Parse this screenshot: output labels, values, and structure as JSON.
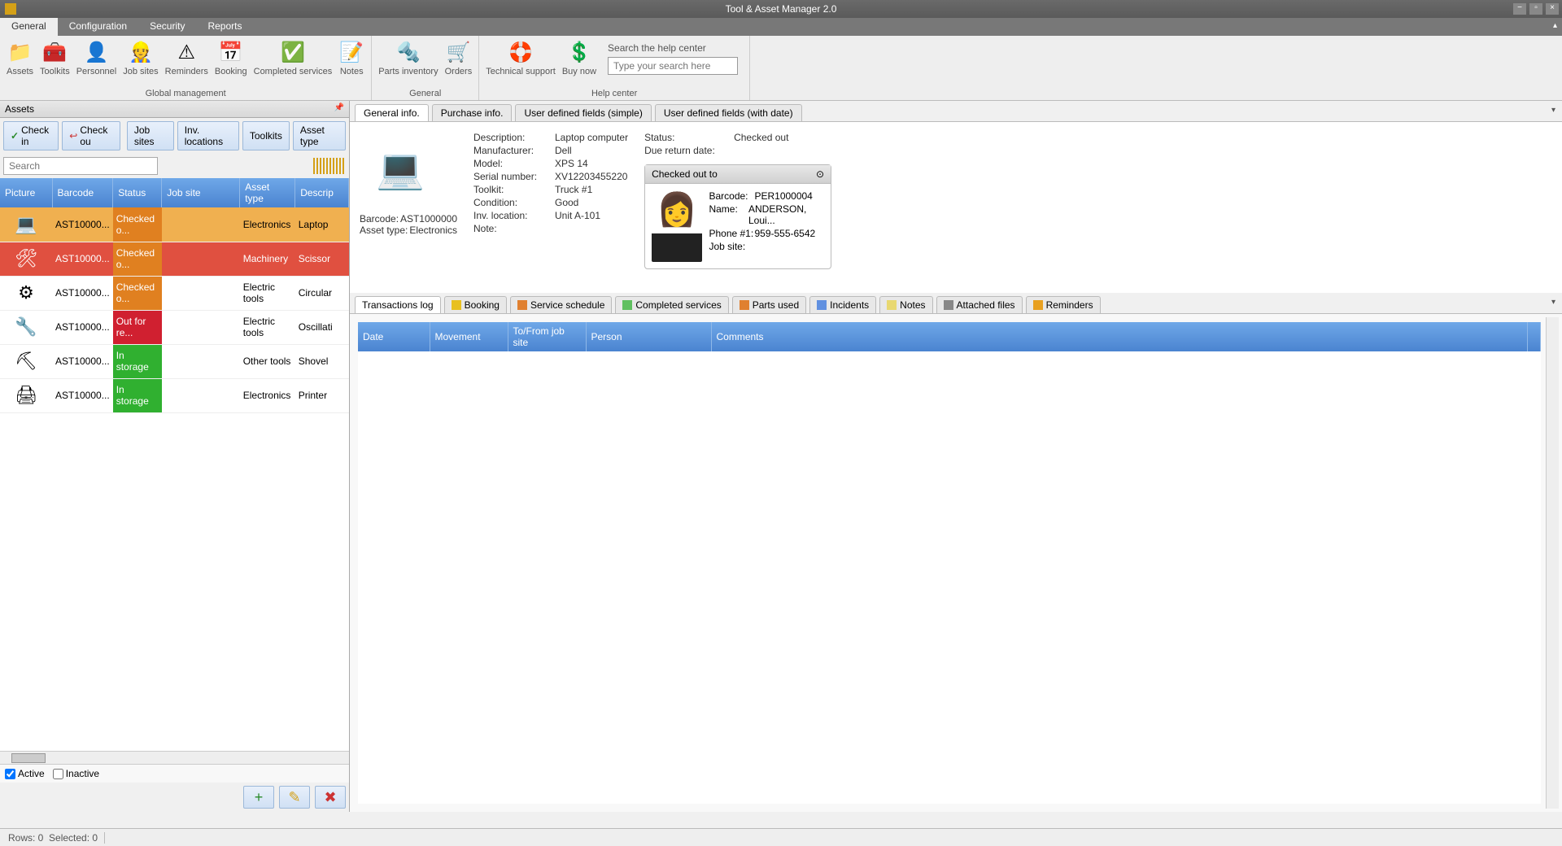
{
  "titlebar": {
    "title": "Tool & Asset Manager 2.0"
  },
  "tabs": {
    "general": "General",
    "config": "Configuration",
    "security": "Security",
    "reports": "Reports"
  },
  "ribbon": {
    "assets": "Assets",
    "toolkits": "Toolkits",
    "personnel": "Personnel",
    "jobsites": "Job sites",
    "reminders": "Reminders",
    "booking": "Booking",
    "completed": "Completed services",
    "notes": "Notes",
    "parts": "Parts inventory",
    "orders": "Orders",
    "support": "Technical support",
    "buy": "Buy now",
    "group1": "Global management",
    "group2": "General",
    "group3": "Help center",
    "searchLabel": "Search the help center",
    "searchPlaceholder": "Type your search here"
  },
  "leftPanel": {
    "title": "Assets",
    "checkin": "Check in",
    "checkout": "Check ou",
    "jobsites": "Job sites",
    "invloc": "Inv. locations",
    "toolkits": "Toolkits",
    "assettype": "Asset type",
    "searchPlaceholder": "Search",
    "cols": {
      "picture": "Picture",
      "barcode": "Barcode",
      "status": "Status",
      "jobsite": "Job site",
      "assettype": "Asset type",
      "desc": "Descrip"
    },
    "rows": [
      {
        "barcode": "AST10000...",
        "status": "Checked o...",
        "statusClass": "orange",
        "jobsite": "",
        "atype": "Electronics",
        "desc": "Laptop",
        "sel": true,
        "pic": "💻"
      },
      {
        "barcode": "AST10000...",
        "status": "Checked o...",
        "statusClass": "orange",
        "jobsite": "",
        "atype": "Machinery",
        "desc": "Scissor",
        "rowRed": true,
        "pic": "🛠"
      },
      {
        "barcode": "AST10000...",
        "status": "Checked o...",
        "statusClass": "orange",
        "jobsite": "",
        "atype": "Electric tools",
        "desc": "Circular",
        "pic": "⚙"
      },
      {
        "barcode": "AST10000...",
        "status": "Out for re...",
        "statusClass": "red",
        "jobsite": "",
        "atype": "Electric tools",
        "desc": "Oscillati",
        "pic": "🔧"
      },
      {
        "barcode": "AST10000...",
        "status": "In storage",
        "statusClass": "green",
        "jobsite": "",
        "atype": "Other tools",
        "desc": "Shovel",
        "pic": "⛏"
      },
      {
        "barcode": "AST10000...",
        "status": "In storage",
        "statusClass": "green",
        "jobsite": "",
        "atype": "Electronics",
        "desc": "Printer",
        "pic": "🖨"
      }
    ],
    "active": "Active",
    "inactive": "Inactive"
  },
  "detailTabs": {
    "general": "General info.",
    "purchase": "Purchase info.",
    "udf": "User defined fields (simple)",
    "udfd": "User defined fields (with date)"
  },
  "detail": {
    "labels": {
      "desc": "Description:",
      "mfr": "Manufacturer:",
      "model": "Model:",
      "serial": "Serial number:",
      "toolkit": "Toolkit:",
      "cond": "Condition:",
      "invloc": "Inv. location:",
      "note": "Note:",
      "barcode": "Barcode:",
      "atype": "Asset type:",
      "status": "Status:",
      "due": "Due return date:"
    },
    "vals": {
      "desc": "Laptop computer",
      "mfr": "Dell",
      "model": "XPS 14",
      "serial": "XV12203455220",
      "toolkit": "Truck #1",
      "cond": "Good",
      "invloc": "Unit A-101",
      "note": "",
      "barcode": "AST1000000",
      "atype": "Electronics",
      "status": "Checked out",
      "due": ""
    }
  },
  "checkout": {
    "header": "Checked out to",
    "labels": {
      "barcode": "Barcode:",
      "name": "Name:",
      "phone": "Phone #1:",
      "jobsite": "Job site:"
    },
    "vals": {
      "barcode": "PER1000004",
      "name": "ANDERSON, Loui...",
      "phone": "959-555-6542",
      "jobsite": ""
    }
  },
  "logTabs": {
    "tlog": "Transactions log",
    "booking": "Booking",
    "schedule": "Service schedule",
    "completed": "Completed services",
    "parts": "Parts used",
    "incidents": "Incidents",
    "notes": "Notes",
    "files": "Attached files",
    "reminders": "Reminders"
  },
  "logCols": {
    "date": "Date",
    "movement": "Movement",
    "tofrom": "To/From job site",
    "person": "Person",
    "comments": "Comments"
  },
  "status": {
    "rows": "Rows: 0",
    "sel": "Selected: 0"
  }
}
